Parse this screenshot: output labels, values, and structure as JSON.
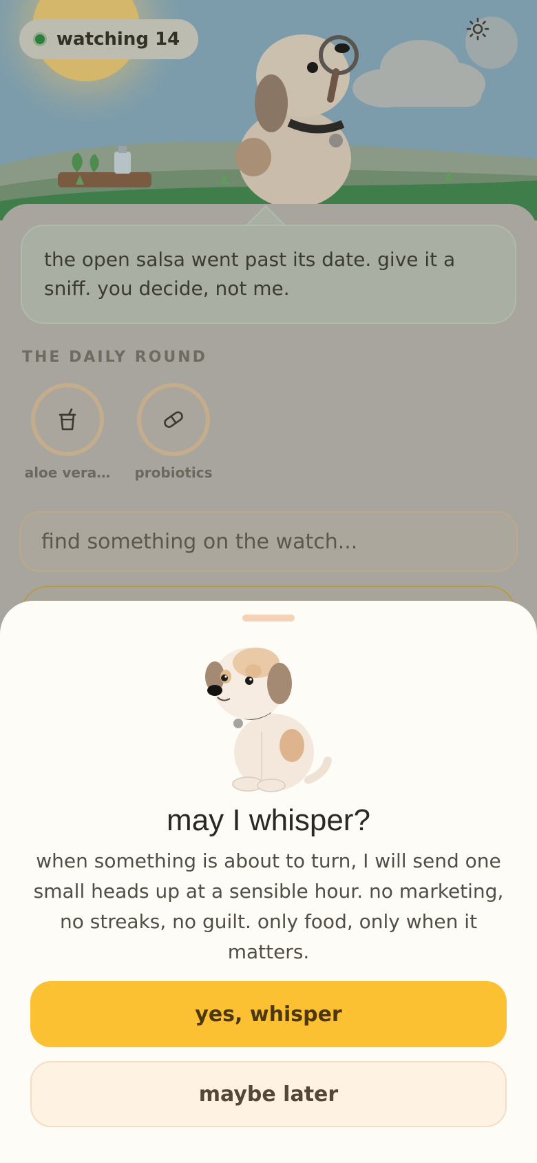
{
  "status": {
    "watching_label": "watching 14",
    "indicator_color": "#2e7d3d"
  },
  "header": {
    "settings_icon": "gear-icon"
  },
  "message": {
    "text": "the open salsa went past its date. give it a sniff. you decide, not me."
  },
  "daily_round": {
    "title": "THE DAILY ROUND",
    "items": [
      {
        "label": "aloe vera…",
        "icon": "cup-icon"
      },
      {
        "label": "probiotics",
        "icon": "pill-icon"
      }
    ]
  },
  "search": {
    "placeholder": "find something on the watch..."
  },
  "modal": {
    "title": "may I whisper?",
    "body": "when something is about to turn, I will send one small heads up at a sensible hour. no marketing, no streaks, no guilt. only food, only when it matters.",
    "primary_button": "yes, whisper",
    "secondary_button": "maybe later",
    "accent_color": "#fcc132"
  }
}
